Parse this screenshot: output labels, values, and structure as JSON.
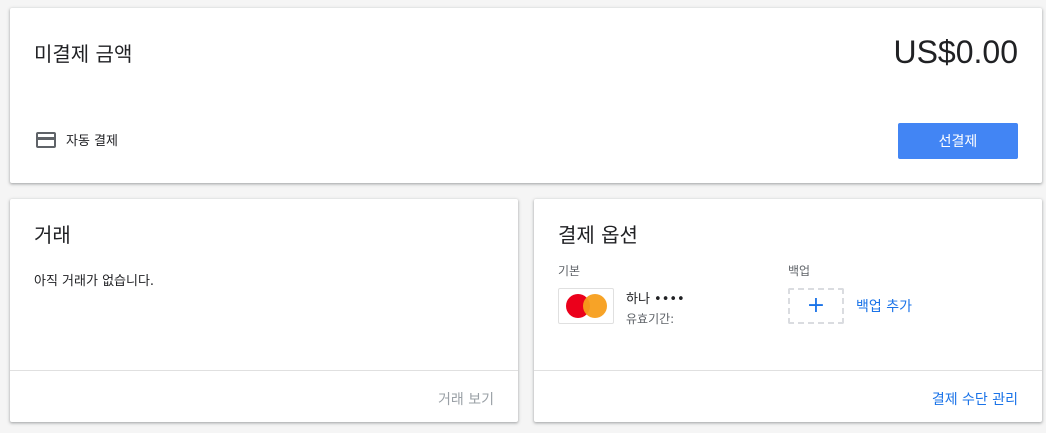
{
  "balance": {
    "title": "미결제 금액",
    "amount": "US$0.00",
    "autopay_label": "자동 결제",
    "autopay_icon": "credit-card-icon",
    "prepay_button": "선결제"
  },
  "transactions": {
    "title": "거래",
    "empty_text": "아직 거래가 없습니다.",
    "view_link": "거래 보기"
  },
  "payment_options": {
    "title": "결제 옵션",
    "primary_label": "기본",
    "backup_label": "백업",
    "card": {
      "name": "하나 ••••",
      "expiry_label": "유효기간:",
      "brand_icon": "mastercard-icon"
    },
    "add_backup_icon": "plus-icon",
    "add_backup_label": "백업 추가",
    "manage_link": "결제 수단 관리"
  },
  "colors": {
    "accent": "#4285f4",
    "link": "#1a73e8",
    "disabled_link": "#9aa0a6"
  }
}
